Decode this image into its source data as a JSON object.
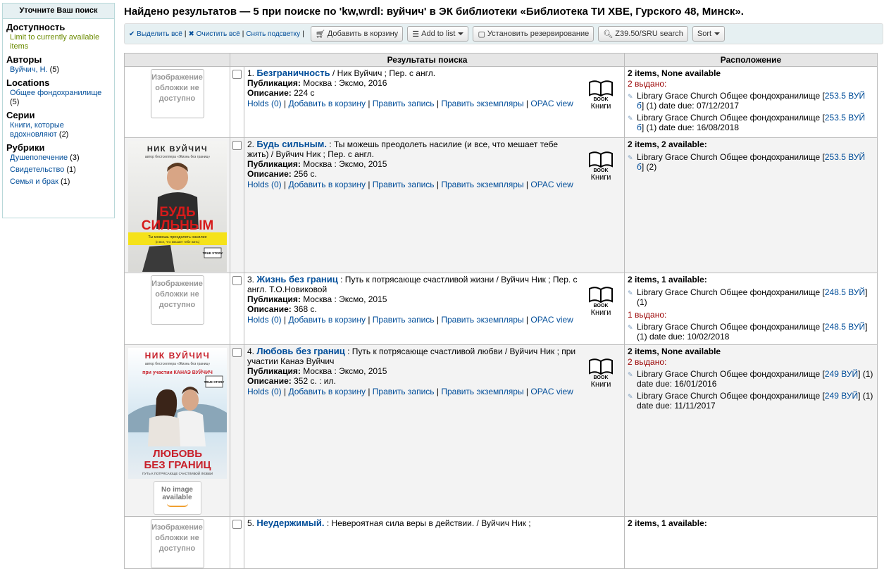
{
  "facets": {
    "header": "Уточните Ваш поиск",
    "groups": [
      {
        "title": "Доступность",
        "items": [
          {
            "label": "Limit to currently available items",
            "count": ""
          }
        ]
      },
      {
        "title": "Авторы",
        "items": [
          {
            "label": "Вуйчич, Н.",
            "count": "(5)"
          }
        ]
      },
      {
        "title": "Locations",
        "items": [
          {
            "label": "Общее фондохранилище",
            "count": "(5)"
          }
        ]
      },
      {
        "title": "Серии",
        "items": [
          {
            "label": "Книги, которые вдохновляют",
            "count": "(2)"
          }
        ]
      },
      {
        "title": "Рубрики",
        "items": [
          {
            "label": "Душепопечение",
            "count": "(3)"
          },
          {
            "label": "Свидетельство",
            "count": "(1)"
          },
          {
            "label": "Семья и брак",
            "count": "(1)"
          }
        ]
      }
    ]
  },
  "heading": "Найдено результатов — 5 при поиске по 'kw,wrdl: вуйчич' в ЭК библиотеки «Библиотека ТИ ХВЕ, Гурского 48, Минск».",
  "toolbar": {
    "select_all": "Выделить всё",
    "clear_all": "Очистить всё",
    "unhighlight": "Снять подсветку",
    "add_to_cart": "Добавить в корзину",
    "add_to_list": "Add to list",
    "place_hold": "Установить резервирование",
    "z3950": "Z39.50/SRU search",
    "sort": "Sort"
  },
  "table": {
    "col_results": "Результаты поиска",
    "col_location": "Расположение"
  },
  "labels": {
    "no_cover": "Изображение обложки не доступно",
    "no_image": "No image available",
    "publication": "Публикация:",
    "description": "Описание:",
    "format": "Книги",
    "format_icon_text": "BOOK",
    "holds": "Holds (0)",
    "add_cart": "Добавить в корзину",
    "edit_record": "Править запись",
    "edit_items": "Править экземпляры",
    "opac": "OPAC view"
  },
  "covers": {
    "r2": {
      "author": "НИК ВУЙЧИЧ",
      "tagline": "автор бестселлера «Жизнь без границ»",
      "title1": "БУДЬ",
      "title2": "СИЛЬНЫМ",
      "sub1": "Ты можешь преодолеть насилие",
      "sub2": "(и все, что мешает тебе жить)",
      "badge": "TRUE STORY"
    },
    "r4": {
      "author": "НИК ВУЙЧИЧ",
      "tagline": "автор бестселлера «Жизнь без границ»",
      "with": "при участии КАНАЭ ВУЙЧИЧ",
      "title1": "ЛЮБОВЬ",
      "title2": "БЕЗ ГРАНИЦ",
      "sub1": "ПУТЬ К ПОТРЯСАЮЩЕ СЧАСТЛИВОЙ ЛЮБВИ",
      "badge": "TRUE STORY"
    }
  },
  "results": [
    {
      "num": "1.",
      "title": "Безграничность",
      "rest": " / Ник Вуйчич ; Пер. с англ.",
      "publication": "Москва : Эксмо, 2016",
      "description": "224 с",
      "avail": "2 items, None available",
      "out_label": "2 выдано:",
      "items": [
        {
          "pre": "Library Grace Church Общее фондохранилище [",
          "call": "253.5 ВУЙ б",
          "post": "] (1) date due: 07/12/2017"
        },
        {
          "pre": "Library Grace Church Общее фондохранилище [",
          "call": "253.5 ВУЙ б",
          "post": "] (1) date due: 16/08/2018"
        }
      ]
    },
    {
      "num": "2.",
      "title": "Будь сильным.",
      "rest": " : Ты можешь преодолеть насилие (и все, что мешает тебе жить) / Вуйчич Ник ; Пер. с англ.",
      "publication": "Москва : Эксмо, 2015",
      "description": "256 с.",
      "avail": "2 items, 2 available:",
      "items": [
        {
          "pre": "Library Grace Church Общее фондохранилище [",
          "call": "253.5 ВУЙ б",
          "post": "] (2)"
        }
      ]
    },
    {
      "num": "3.",
      "title": "Жизнь без границ",
      "rest": " : Путь к потрясающе счастливой жизни / Вуйчич Ник ; Пер. с англ. Т.О.Новиковой",
      "publication": "Москва : Эксмо, 2015",
      "description": "368 с.",
      "avail": "2 items, 1 available:",
      "items": [
        {
          "pre": "Library Grace Church Общее фондохранилище [",
          "call": "248.5 ВУЙ",
          "post": "] (1)"
        }
      ],
      "out_label": "1 выдано:",
      "out_items": [
        {
          "pre": "Library Grace Church Общее фондохранилище [",
          "call": "248.5 ВУЙ",
          "post": "] (1) date due: 10/02/2018"
        }
      ]
    },
    {
      "num": "4.",
      "title": "Любовь без границ",
      "rest": " : Путь к потрясающе счастливой любви / Вуйчич Ник ; при участии Канаэ Вуйчич",
      "publication": "Москва : Эксмо, 2015",
      "description": "352 с. : ил.",
      "avail": "2 items, None available",
      "out_label": "2 выдано:",
      "items": [
        {
          "pre": "Library Grace Church Общее фондохранилище [",
          "call": "249 ВУЙ",
          "post": "] (1) date due: 16/01/2016"
        },
        {
          "pre": "Library Grace Church Общее фондохранилище [",
          "call": "249 ВУЙ",
          "post": "] (1) date due: 11/11/2017"
        }
      ]
    },
    {
      "num": "5.",
      "title": "Неудержимый.",
      "rest": " : Невероятная сила веры в действии. / Вуйчич Ник ;",
      "avail": "2 items, 1 available:"
    }
  ]
}
